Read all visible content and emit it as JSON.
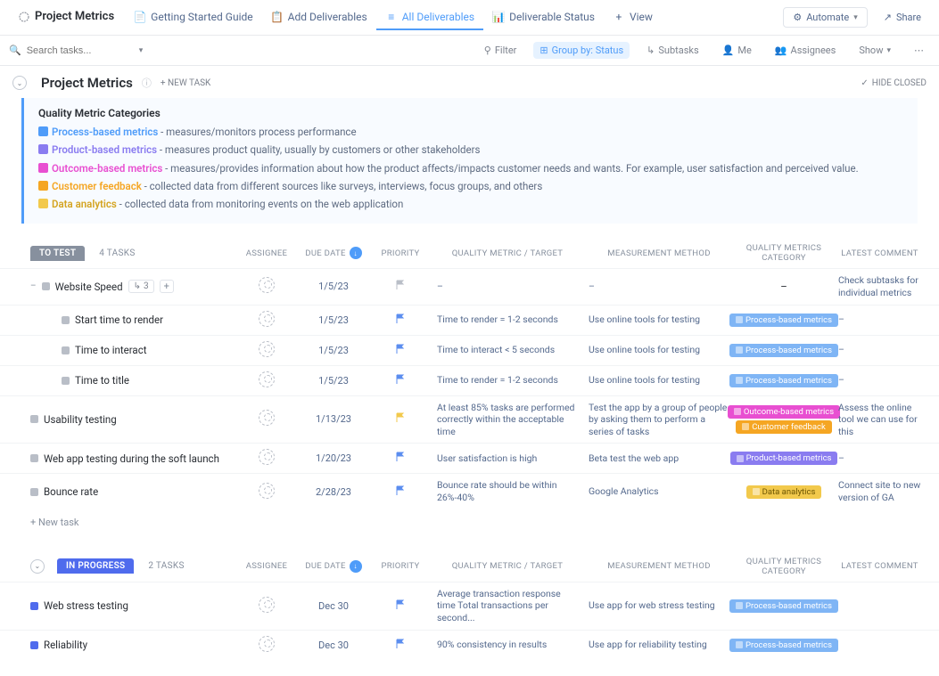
{
  "topbar": {
    "project": "Project Metrics",
    "tabs": [
      {
        "label": "Getting Started Guide"
      },
      {
        "label": "Add Deliverables"
      },
      {
        "label": "All Deliverables",
        "active": true
      },
      {
        "label": "Deliverable Status"
      },
      {
        "label": "View"
      }
    ],
    "automate": "Automate",
    "share": "Share"
  },
  "filterbar": {
    "search_placeholder": "Search tasks...",
    "filter": "Filter",
    "groupby": "Group by: Status",
    "subtasks": "Subtasks",
    "me": "Me",
    "assignees": "Assignees",
    "show": "Show"
  },
  "pagehead": {
    "title": "Project Metrics",
    "newtask": "+ NEW TASK",
    "hide_closed": "HIDE CLOSED"
  },
  "infobox": {
    "heading": "Quality Metric Categories",
    "rows": [
      {
        "icon_bg": "#4f9cf9",
        "name": "Process-based metrics",
        "name_color": "#4f9cf9",
        "desc": " - measures/monitors process performance"
      },
      {
        "icon_bg": "#8a7cf0",
        "name": "Product-based metrics",
        "name_color": "#8a7cf0",
        "desc": " - measures product quality, usually by  customers or other stakeholders"
      },
      {
        "icon_bg": "#e84fd1",
        "name": "Outcome-based metrics",
        "name_color": "#e84fd1",
        "desc": " - measures/provides information about how the product affects/impacts customer needs and wants. For example, user satisfaction and perceived value."
      },
      {
        "icon_bg": "#f5a623",
        "name": "Customer feedback",
        "name_color": "#f5a623",
        "desc": " - collected data from different sources like surveys, interviews, focus groups, and others"
      },
      {
        "icon_bg": "#f2c94c",
        "name": "Data analytics",
        "name_color": "#d4a420",
        "desc": " - collected data from monitoring events on the web application"
      }
    ]
  },
  "columns": {
    "assignee": "ASSIGNEE",
    "due": "DUE DATE",
    "priority": "PRIORITY",
    "metric": "QUALITY METRIC / TARGET",
    "method": "MEASUREMENT METHOD",
    "category": "QUALITY METRICS CATEGORY",
    "comment": "LATEST COMMENT"
  },
  "groups": [
    {
      "status": "TO TEST",
      "status_bg": "#87909e",
      "count": "4 TASKS",
      "tasks": [
        {
          "name": "Website Speed",
          "sub_count": "3",
          "due": "1/5/23",
          "flag": "#b9bec7",
          "metric": "–",
          "method": "–",
          "categories": [],
          "comment": "Check subtasks for individual metrics",
          "has_sub_badge": true,
          "status_sq": "sq-gray"
        },
        {
          "name": "Start time to render",
          "sub": true,
          "due": "1/5/23",
          "flag": "#5b8def",
          "metric": "Time to render = 1-2 seconds",
          "method": "Use online tools for testing",
          "categories": [
            {
              "label": "Process-based metrics",
              "bg": "#7fb5f5"
            }
          ],
          "comment": "–",
          "status_sq": "sq-gray"
        },
        {
          "name": "Time to interact",
          "sub": true,
          "due": "1/5/23",
          "flag": "#5b8def",
          "metric": "Time to interact < 5 seconds",
          "method": "Use online tools for testing",
          "categories": [
            {
              "label": "Process-based metrics",
              "bg": "#7fb5f5"
            }
          ],
          "comment": "–",
          "status_sq": "sq-gray"
        },
        {
          "name": "Time to title",
          "sub": true,
          "due": "1/5/23",
          "flag": "#5b8def",
          "metric": "Time to render = 1-2 seconds",
          "method": "Use online tools for testing",
          "categories": [
            {
              "label": "Process-based metrics",
              "bg": "#7fb5f5"
            }
          ],
          "comment": "–",
          "status_sq": "sq-gray"
        },
        {
          "name": "Usability testing",
          "due": "1/13/23",
          "flag": "#f2c94c",
          "metric": "At least 85% tasks are performed correctly within the acceptable time",
          "method": "Test the app by a group of people by asking them to perform a series of tasks",
          "categories": [
            {
              "label": "Outcome-based metrics",
              "bg": "#e84fd1"
            },
            {
              "label": "Customer feedback",
              "bg": "#f5a623"
            }
          ],
          "comment": "Assess the online tool we can use for this",
          "status_sq": "sq-gray"
        },
        {
          "name": "Web app testing during the soft launch",
          "due": "1/20/23",
          "flag": "#5b8def",
          "metric": "User satisfaction is high",
          "method": "Beta test the web app",
          "categories": [
            {
              "label": "Product-based metrics",
              "bg": "#8a7cf0"
            }
          ],
          "comment": "–",
          "status_sq": "sq-gray"
        },
        {
          "name": "Bounce rate",
          "due": "2/28/23",
          "flag": "#5b8def",
          "metric": "Bounce rate should be within 26%-40%",
          "method": "Google Analytics",
          "categories": [
            {
              "label": "Data analytics",
              "bg": "#f2c94c",
              "fg": "#6b5400"
            }
          ],
          "comment": "Connect site to new version of GA",
          "status_sq": "sq-gray"
        }
      ],
      "newtask": "+ New task"
    },
    {
      "status": "IN PROGRESS",
      "status_bg": "#4f6bed",
      "count": "2 TASKS",
      "tasks": [
        {
          "name": "Web stress testing",
          "due": "Dec 30",
          "flag": "#5b8def",
          "metric": "Average transaction response time Total transactions per second...",
          "method": "Use app for web stress testing",
          "categories": [
            {
              "label": "Process-based metrics",
              "bg": "#7fb5f5"
            }
          ],
          "comment": "",
          "status_sq": "sq-blue"
        },
        {
          "name": "Reliability",
          "due": "Dec 30",
          "flag": "#5b8def",
          "metric": "90% consistency in results",
          "method": "Use app for reliability testing",
          "categories": [
            {
              "label": "Process-based metrics",
              "bg": "#7fb5f5"
            }
          ],
          "comment": "",
          "status_sq": "sq-blue"
        }
      ]
    }
  ]
}
